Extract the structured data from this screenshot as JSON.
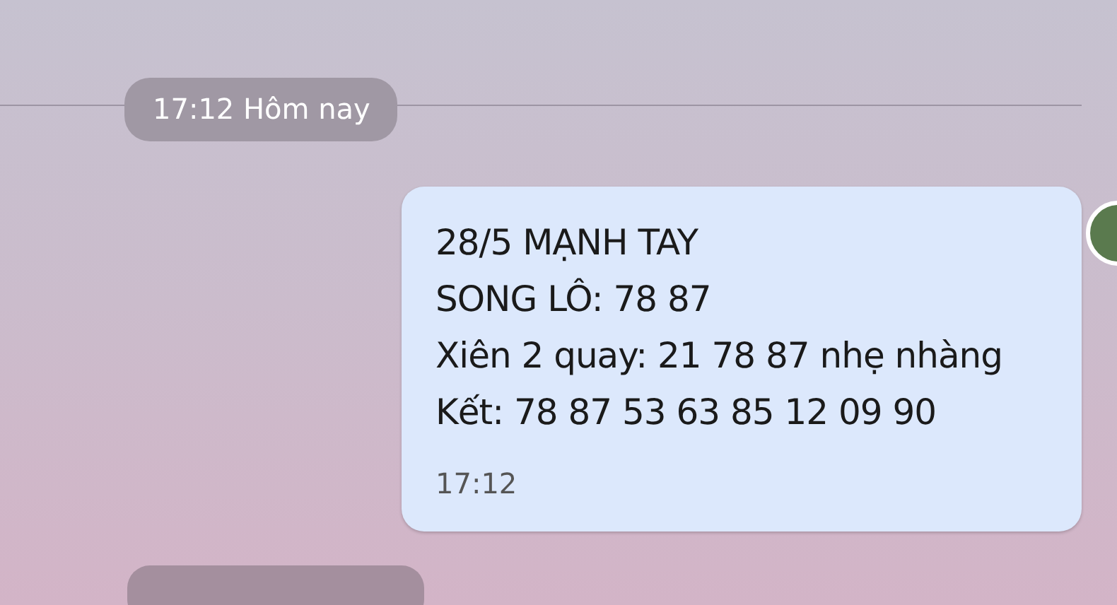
{
  "date_separator": {
    "label": "17:12 Hôm nay"
  },
  "messages": [
    {
      "lines": [
        "28/5 MẠNH TAY",
        "SONG LÔ: 78 87",
        "Xiên 2 quay: 21 78 87 nhẹ nhàng",
        "Kết: 78 87 53 63 85 12 09 90"
      ],
      "time": "17:12"
    }
  ]
}
